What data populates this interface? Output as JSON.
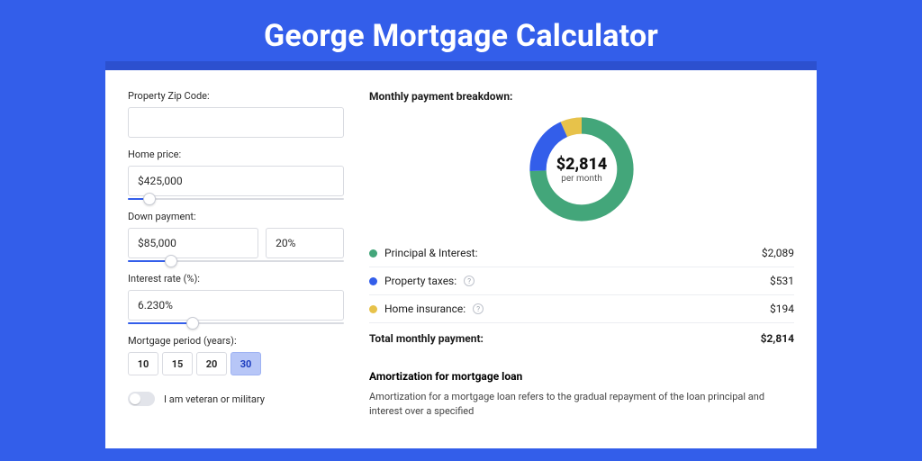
{
  "title": "George Mortgage Calculator",
  "form": {
    "zip_label": "Property Zip Code:",
    "zip_value": "",
    "home_price_label": "Home price:",
    "home_price_value": "$425,000",
    "home_price_slider_pct": 10,
    "down_payment_label": "Down payment:",
    "down_payment_value": "$85,000",
    "down_payment_pct": "20%",
    "down_payment_slider_pct": 20,
    "interest_label": "Interest rate (%):",
    "interest_value": "6.230%",
    "interest_slider_pct": 30,
    "period_label": "Mortgage period (years):",
    "periods": [
      "10",
      "15",
      "20",
      "30"
    ],
    "period_selected": "30",
    "veteran_label": "I am veteran or military",
    "veteran_on": false
  },
  "breakdown": {
    "title": "Monthly payment breakdown:",
    "amount": "$2,814",
    "sub": "per month",
    "items": [
      {
        "key": "principal",
        "label": "Principal & Interest:",
        "value": "$2,089",
        "color": "green",
        "help": false
      },
      {
        "key": "taxes",
        "label": "Property taxes:",
        "value": "$531",
        "color": "blue",
        "help": true
      },
      {
        "key": "insurance",
        "label": "Home insurance:",
        "value": "$194",
        "color": "gold",
        "help": true
      }
    ],
    "total_label": "Total monthly payment:",
    "total_value": "$2,814"
  },
  "chart_data": {
    "type": "pie",
    "title": "Monthly payment breakdown",
    "series": [
      {
        "name": "Principal & Interest",
        "value": 2089,
        "color": "#43a67a"
      },
      {
        "name": "Property taxes",
        "value": 531,
        "color": "#335eea"
      },
      {
        "name": "Home insurance",
        "value": 194,
        "color": "#e7c24a"
      }
    ],
    "total": 2814,
    "center_label": "$2,814 per month"
  },
  "amortization": {
    "title": "Amortization for mortgage loan",
    "body": "Amortization for a mortgage loan refers to the gradual repayment of the loan principal and interest over a specified"
  }
}
